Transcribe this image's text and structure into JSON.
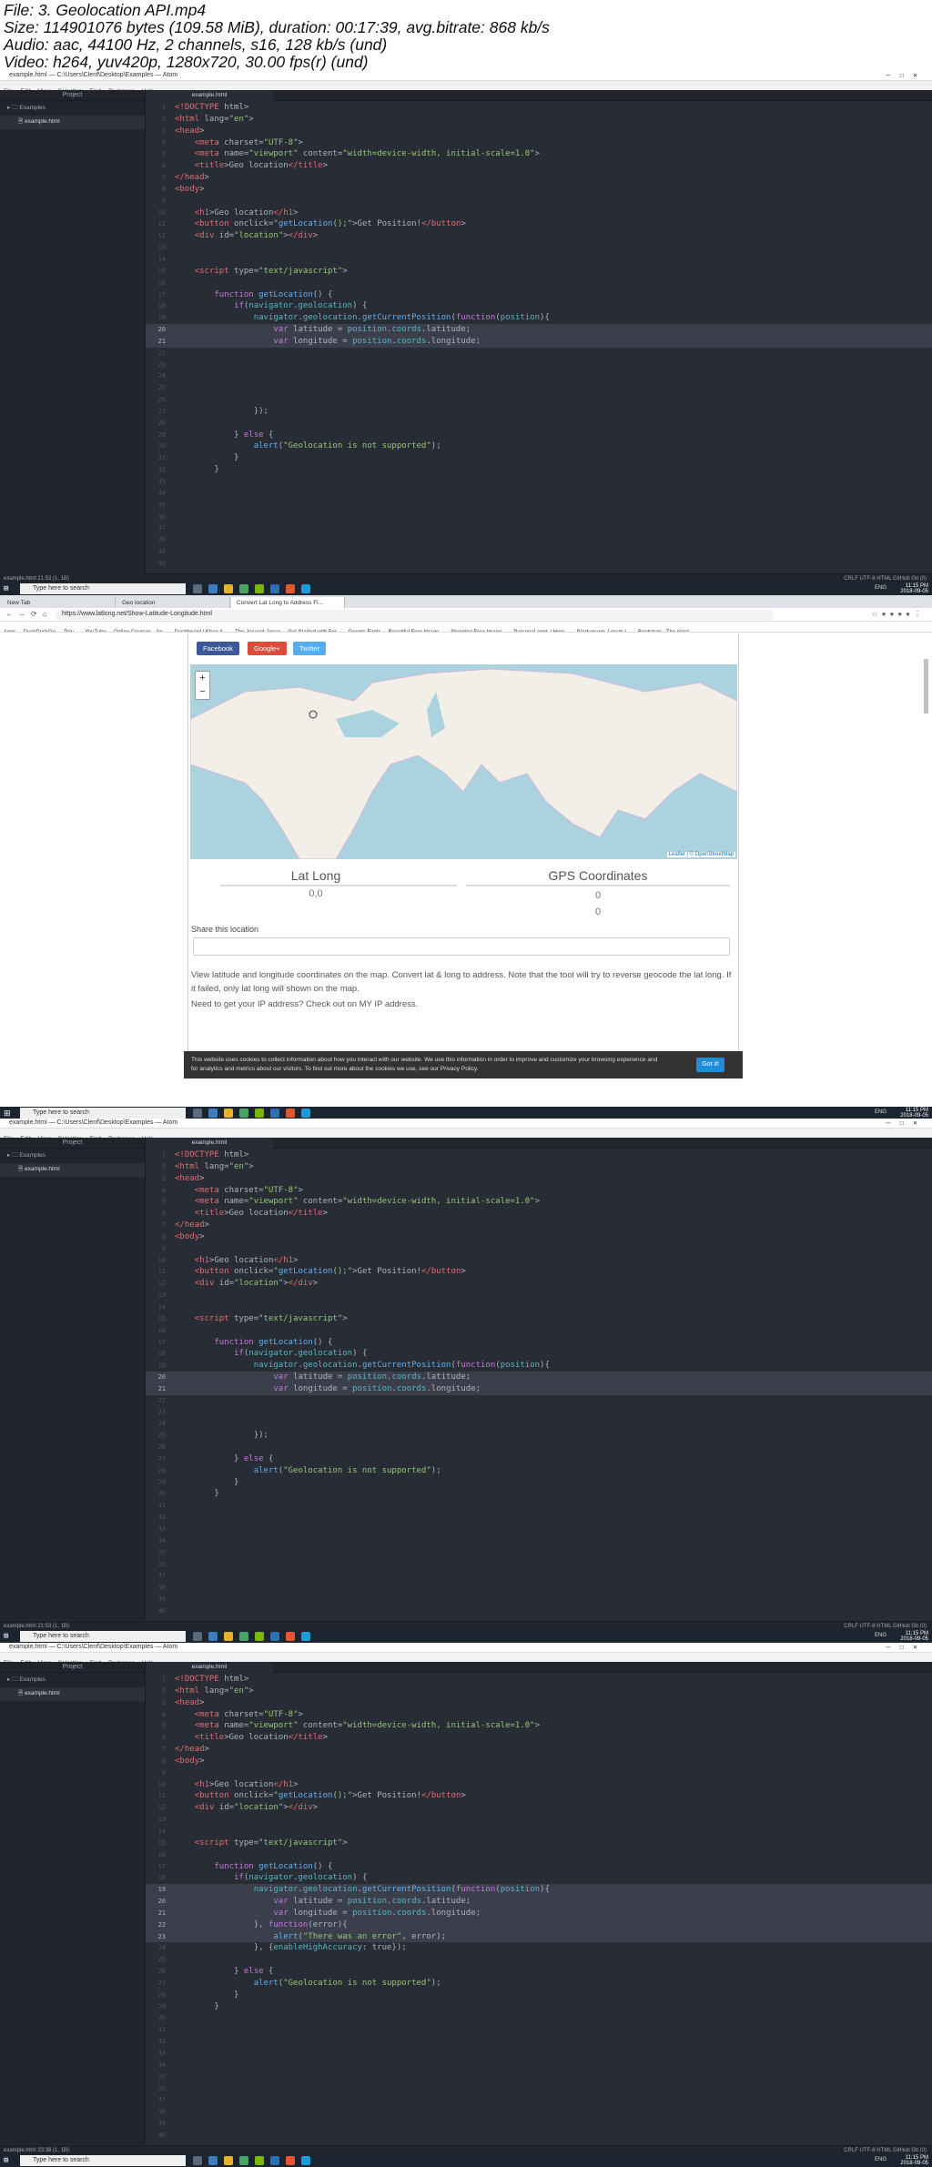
{
  "header": {
    "line1": "File: 3. Geolocation API.mp4",
    "line2": "Size: 114901076 bytes (109.58 MiB), duration: 00:17:39, avg.bitrate: 868 kb/s",
    "line3": "Audio: aac, 44100 Hz, 2 channels, s16, 128 kb/s (und)",
    "line4": "Video: h264, yuv420p, 1280x720, 30.00 fps(r) (und)"
  },
  "atom": {
    "title": "example.html — C:\\Users\\Clenf\\Desktop\\Examples — Atom",
    "menu": [
      "File",
      "Edit",
      "View",
      "Selection",
      "Find",
      "Packages",
      "Help"
    ],
    "project": "Project",
    "folder": "Examples",
    "file": "example.html",
    "tab": "example.html",
    "status_left": "example.html 21:53 (1, 1B)",
    "status_left4": "example.html 23:38 (1, 1B)",
    "status_right": "CRLF   UTF-8   HTML   GitHub   Git (0)"
  },
  "taskbar": {
    "search": "Type here to search",
    "tray": "ENG",
    "time": "11:15 PM",
    "date": "2018-09-05"
  },
  "code1": [
    "<!DOCTYPE html>",
    "<html lang=\"en\">",
    "<head>",
    "    <meta charset=\"UTF-8\">",
    "    <meta name=\"viewport\" content=\"width=device-width, initial-scale=1.0\">",
    "    <title>Geo location</title>",
    "</head>",
    "<body>",
    "",
    "    <h1>Geo location</h1>",
    "    <button onclick=\"getLocation();\">Get Position!</button>",
    "    <div id=\"location\"></div>",
    "",
    "",
    "    <script type=\"text/javascript\">",
    "",
    "        function getLocation() {",
    "            if(navigator.geolocation) {",
    "                navigator.geolocation.getCurrentPosition(function(position){",
    "                    var latitude = position.coords.latitude;",
    "                    var longitude = position.coords.longitude;",
    "",
    "",
    "",
    "",
    "",
    "                });",
    "",
    "            } else {",
    "                alert(\"Geolocation is not supported\");",
    "            }",
    "        }",
    "",
    "",
    "",
    "",
    "",
    "",
    "",
    ""
  ],
  "code3": [
    "<!DOCTYPE html>",
    "<html lang=\"en\">",
    "<head>",
    "    <meta charset=\"UTF-8\">",
    "    <meta name=\"viewport\" content=\"width=device-width, initial-scale=1.0\">",
    "    <title>Geo location</title>",
    "</head>",
    "<body>",
    "",
    "    <h1>Geo location</h1>",
    "    <button onclick=\"getLocation();\">Get Position!</button>",
    "    <div id=\"location\"></div>",
    "",
    "",
    "    <script type=\"text/javascript\">",
    "",
    "        function getLocation() {",
    "            if(navigator.geolocation) {",
    "                navigator.geolocation.getCurrentPosition(function(position){",
    "                    var latitude = position.coords.latitude;",
    "                    var longitude = position.coords.longitude;",
    "",
    "",
    "",
    "                });",
    "",
    "            } else {",
    "                alert(\"Geolocation is not supported\");",
    "            }",
    "        }",
    "",
    "",
    "",
    "",
    "",
    "",
    "",
    "",
    "",
    ""
  ],
  "code4": [
    "<!DOCTYPE html>",
    "<html lang=\"en\">",
    "<head>",
    "    <meta charset=\"UTF-8\">",
    "    <meta name=\"viewport\" content=\"width=device-width, initial-scale=1.0\">",
    "    <title>Geo location</title>",
    "</head>",
    "<body>",
    "",
    "    <h1>Geo location</h1>",
    "    <button onclick=\"getLocation();\">Get Position!</button>",
    "    <div id=\"location\"></div>",
    "",
    "",
    "    <script type=\"text/javascript\">",
    "",
    "        function getLocation() {",
    "            if(navigator.geolocation) {",
    "                navigator.geolocation.getCurrentPosition(function(position){",
    "                    var latitude = position.coords.latitude;",
    "                    var longitude = position.coords.longitude;",
    "                }, function(error){",
    "                    alert(\"There was an error\", error);",
    "                }, {enableHighAccuracy: true});",
    "",
    "            } else {",
    "                alert(\"Geolocation is not supported\");",
    "            }",
    "        }",
    "",
    "",
    "",
    "",
    "",
    "",
    "",
    "",
    "",
    "",
    ""
  ],
  "browser": {
    "tabs": [
      "New Tab",
      "Geo location",
      "Convert Lat Long to Address Fi..."
    ],
    "url": "https://www.latlong.net/Show-Latitude-Longitude.html",
    "bookmarks": [
      "Apps",
      "DuckDuckGo — Priv...",
      "YouTube",
      "Online Courses - An...",
      "Dashboard | Khan A...",
      "The Jesuset Jesse",
      "Get Started with For...",
      "Google Fonts",
      "Beautiful Free Image...",
      "Stunning Free Image...",
      "Personal apps | Here...",
      "Startupsum: Lorem I...",
      "Bootstrap · The most..."
    ],
    "social": [
      "Facebook",
      "Google+",
      "Twitter"
    ],
    "attribution": "Leaflet | © OpenStreetMap",
    "lat_long_head": "Lat Long",
    "gps_head": "GPS Coordinates",
    "lat_long_val": "0,0",
    "gps_val1": "0",
    "gps_val2": "0",
    "share_label": "Share this location",
    "para1": "View latitude and longitude coordinates on the map. Convert lat & long to address. Note that the tool will try to reverse geocode the lat long. If it failed, only lat long will shown on the map.",
    "para2": "Need to get your IP address? Check out on MY IP address.",
    "cookie": "This website uses cookies to collect information about how you interact with our website. We use this information in order to improve and customize your browsing experience and for analytics and metrics about our visitors. To find out more about the cookies we use, see our Privacy Policy.",
    "cookie_btn": "Got it!"
  },
  "colors": {
    "atom_bg": "#282c34",
    "tree_bg": "#21252b",
    "facebook": "#3b5998",
    "google": "#dd4b39",
    "twitter": "#55acee",
    "sea": "#aad3df",
    "land": "#f2efe9"
  }
}
